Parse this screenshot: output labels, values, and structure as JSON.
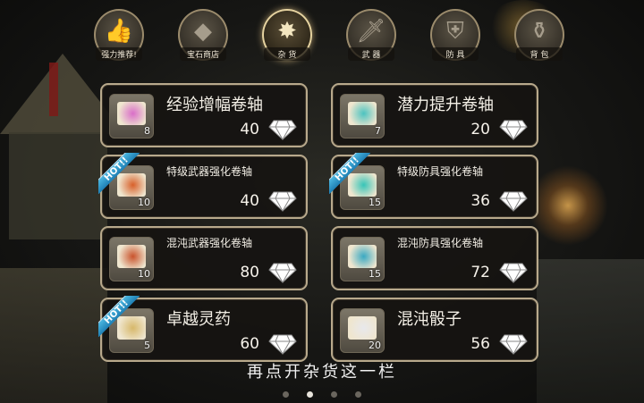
{
  "tabs": [
    {
      "label": "强力推荐!",
      "icon": "thumbs-up-icon",
      "glyph": "👍"
    },
    {
      "label": "宝石商店",
      "icon": "diamond-icon",
      "glyph": "◆"
    },
    {
      "label": "杂 货",
      "icon": "compass-icon",
      "glyph": "✸",
      "active": true
    },
    {
      "label": "武 器",
      "icon": "sword-icon",
      "glyph": "🗡"
    },
    {
      "label": "防 具",
      "icon": "shield-icon",
      "glyph": "⛨"
    },
    {
      "label": "背 包",
      "icon": "bag-icon",
      "glyph": "⚱"
    }
  ],
  "items": [
    {
      "name": "经验增幅卷轴",
      "price": "40",
      "qty": "8",
      "hot": false,
      "icon": "pink-scroll-icon",
      "color": "#d96ec8"
    },
    {
      "name": "潜力提升卷轴",
      "price": "20",
      "qty": "7",
      "hot": false,
      "icon": "teal-scroll-icon",
      "color": "#4cc3c0"
    },
    {
      "name": "特级武器强化卷轴",
      "price": "40",
      "qty": "10",
      "hot": true,
      "icon": "orange-scroll-icon",
      "color": "#d8602a"
    },
    {
      "name": "特级防具强化卷轴",
      "price": "36",
      "qty": "15",
      "hot": true,
      "icon": "cyan-scroll-icon",
      "color": "#37c5b8"
    },
    {
      "name": "混沌武器强化卷轴",
      "price": "80",
      "qty": "10",
      "hot": false,
      "icon": "red-scroll-icon",
      "color": "#c9532c"
    },
    {
      "name": "混沌防具强化卷轴",
      "price": "72",
      "qty": "15",
      "hot": false,
      "icon": "blue-scroll-icon",
      "color": "#3aa9c2"
    },
    {
      "name": "卓越灵药",
      "price": "60",
      "qty": "5",
      "hot": true,
      "icon": "potion-vase-icon",
      "color": "#d7b86a"
    },
    {
      "name": "混沌骰子",
      "price": "56",
      "qty": "20",
      "hot": false,
      "icon": "dice-icon",
      "color": "#e8e8ec"
    }
  ],
  "hot_label": "HOT!!",
  "caption": "再点开杂货这一栏",
  "pagination": {
    "pages": 4,
    "current": 1
  }
}
